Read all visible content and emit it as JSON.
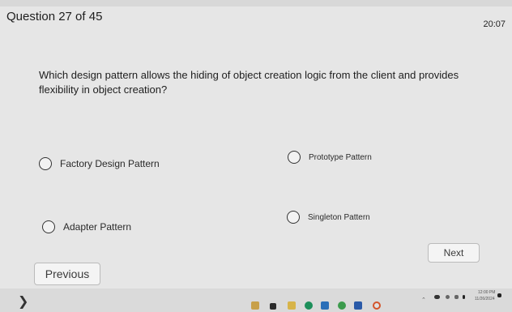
{
  "quiz": {
    "header": "Question 27 of 45",
    "timer": "20:07",
    "question": "Which design pattern allows the hiding of object creation logic from the client and provides flexibility in object creation?",
    "options": [
      {
        "label": "Factory Design Pattern"
      },
      {
        "label": "Prototype Pattern"
      },
      {
        "label": "Adapter Pattern"
      },
      {
        "label": "Singleton Pattern"
      }
    ],
    "next_label": "Next",
    "previous_label": "Previous"
  },
  "taskbar": {
    "clock_time": "12:00 PM",
    "clock_date": "11/26/2024",
    "icons": [
      "folder-icon",
      "terminal-icon",
      "edge-icon",
      "store-icon",
      "chrome-icon",
      "word-icon",
      "record-icon"
    ],
    "tray_icons": [
      "chevron-up-icon",
      "cloud-icon",
      "wifi-icon",
      "speaker-icon",
      "notification-icon"
    ]
  }
}
